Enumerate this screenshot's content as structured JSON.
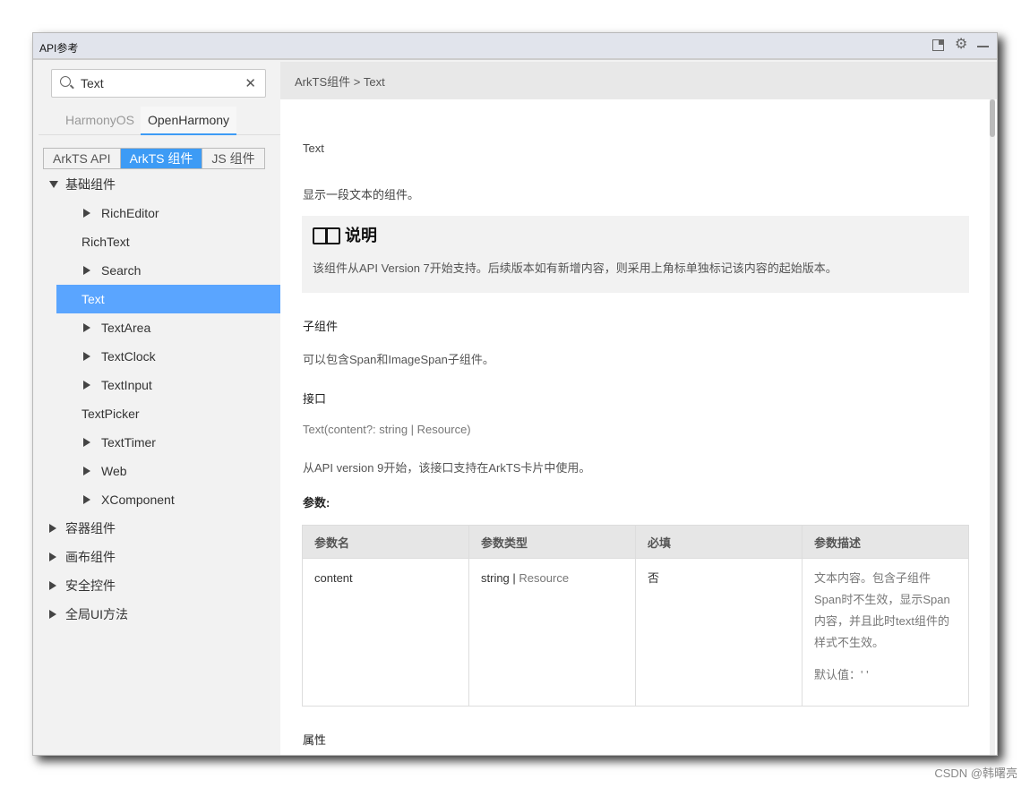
{
  "window": {
    "title": "API参考",
    "icons": [
      "dock-icon",
      "gear-icon",
      "minimize-icon"
    ]
  },
  "sidebar": {
    "search": {
      "value": "Text",
      "placeholder": ""
    },
    "os_tabs": [
      {
        "label": "HarmonyOS",
        "active": false
      },
      {
        "label": "OpenHarmony",
        "active": true
      }
    ],
    "segments": [
      {
        "label": "ArkTS API",
        "active": false
      },
      {
        "label": "ArkTS 组件",
        "active": true
      },
      {
        "label": "JS 组件",
        "active": false
      }
    ],
    "tree": [
      {
        "label": "基础组件",
        "level": 0,
        "arrow": "down"
      },
      {
        "label": "RichEditor",
        "level": 1,
        "arrow": "right"
      },
      {
        "label": "RichText",
        "level": 1,
        "arrow": "none"
      },
      {
        "label": "Search",
        "level": 1,
        "arrow": "right"
      },
      {
        "label": "Text",
        "level": 1,
        "arrow": "none",
        "selected": true
      },
      {
        "label": "TextArea",
        "level": 1,
        "arrow": "right"
      },
      {
        "label": "TextClock",
        "level": 1,
        "arrow": "right"
      },
      {
        "label": "TextInput",
        "level": 1,
        "arrow": "right"
      },
      {
        "label": "TextPicker",
        "level": 1,
        "arrow": "none"
      },
      {
        "label": "TextTimer",
        "level": 1,
        "arrow": "right"
      },
      {
        "label": "Web",
        "level": 1,
        "arrow": "right"
      },
      {
        "label": "XComponent",
        "level": 1,
        "arrow": "right"
      },
      {
        "label": "容器组件",
        "level": 0,
        "arrow": "right"
      },
      {
        "label": "画布组件",
        "level": 0,
        "arrow": "right"
      },
      {
        "label": "安全控件",
        "level": 0,
        "arrow": "right"
      },
      {
        "label": "全局UI方法",
        "level": 0,
        "arrow": "right"
      }
    ]
  },
  "breadcrumb": "ArkTS组件 > Text",
  "doc": {
    "title": "Text",
    "intro": "显示一段文本的组件。",
    "note_title": "说明",
    "note_text": "该组件从API Version 7开始支持。后续版本如有新增内容，则采用上角标单独标记该内容的起始版本。",
    "child_heading": "子组件",
    "child_text": "可以包含Span和ImageSpan子组件。",
    "iface_heading": "接口",
    "iface_sig": "Text(content?: string | Resource)",
    "iface_note": "从API version 9开始，该接口支持在ArkTS卡片中使用。",
    "params_heading": "参数:",
    "table": {
      "headers": [
        "参数名",
        "参数类型",
        "必填",
        "参数描述"
      ],
      "rows": [
        {
          "name": "content",
          "type": "string",
          "type2": "Resource",
          "required": "否",
          "desc": "文本内容。包含子组件Span时不生效，显示Span内容，并且此时text组件的样式不生效。",
          "default": "默认值：' '"
        }
      ]
    },
    "attr_heading": "属性"
  },
  "watermark": "CSDN @韩曙亮"
}
